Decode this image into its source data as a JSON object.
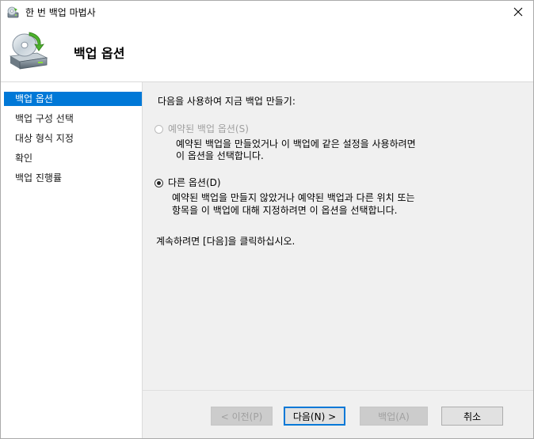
{
  "window": {
    "title": "한 번 백업 마법사",
    "header_title": "백업 옵션"
  },
  "sidebar": {
    "items": [
      {
        "label": "백업 옵션",
        "active": true
      },
      {
        "label": "백업 구성 선택",
        "active": false
      },
      {
        "label": "대상 형식 지정",
        "active": false
      },
      {
        "label": "확인",
        "active": false
      },
      {
        "label": "백업 진행률",
        "active": false
      }
    ]
  },
  "main": {
    "prompt": "다음을 사용하여 지금 백업 만들기:",
    "option_scheduled": {
      "label": "예약된 백업 옵션(S)",
      "desc_line1": "예약된 백업을 만들었거나 이 백업에 같은 설정을 사용하려면",
      "desc_line2": "이 옵션을 선택합니다.",
      "enabled": false,
      "selected": false
    },
    "option_different": {
      "label": "다른 옵션(D)",
      "desc_line1": "예약된 백업을 만들지 않았거나 예약된 백업과 다른 위치 또는",
      "desc_line2": "항목을 이 백업에 대해 지정하려면 이 옵션을 선택합니다.",
      "enabled": true,
      "selected": true
    },
    "continue_text": "계속하려면 [다음]을 클릭하십시오."
  },
  "footer": {
    "prev_label": "< 이전(P)",
    "next_label": "다음(N) >",
    "backup_label": "백업(A)",
    "cancel_label": "취소"
  },
  "colors": {
    "accent": "#0078d7",
    "panel_bg": "#f0f0f0",
    "disabled_text": "#a0a0a0"
  },
  "icons": {
    "title": "backup-drive-icon",
    "header": "backup-drive-icon",
    "close": "close-icon"
  }
}
